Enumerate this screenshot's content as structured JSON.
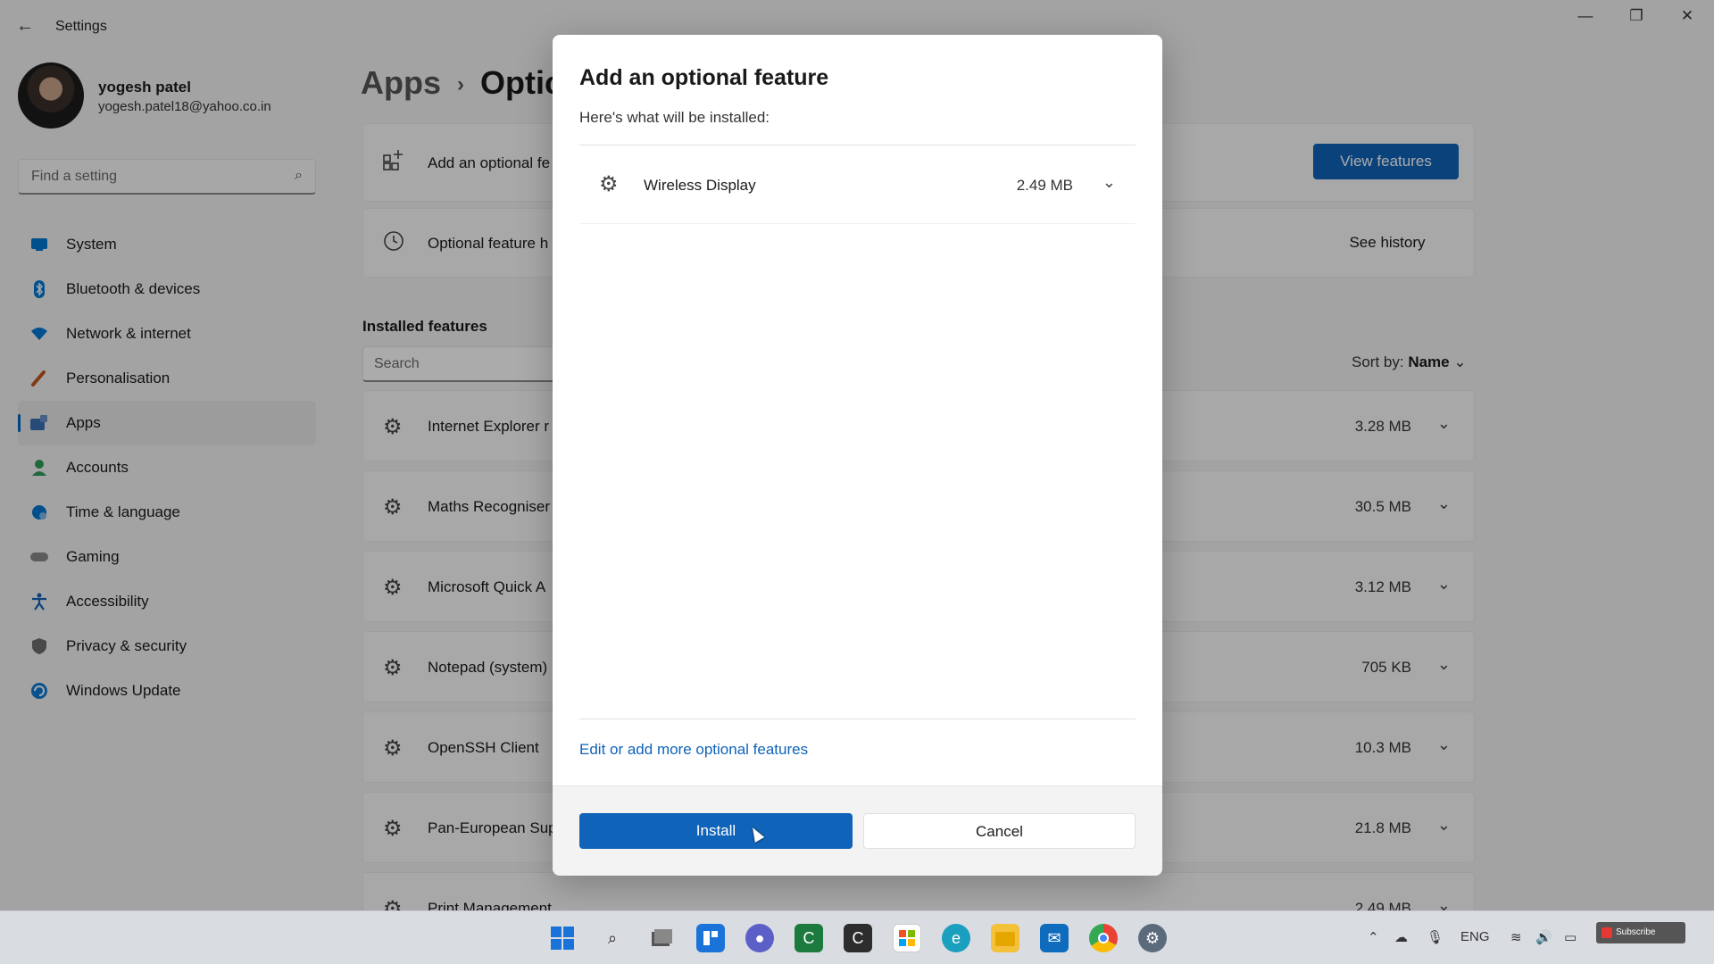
{
  "window": {
    "title": "Settings",
    "back": "←",
    "minimize": "—",
    "maximize": "❐",
    "close": "✕"
  },
  "user": {
    "name": "yogesh patel",
    "email": "yogesh.patel18@yahoo.co.in"
  },
  "sidebar": {
    "search_placeholder": "Find a setting",
    "search_icon": "⌕",
    "items": [
      {
        "label": "System",
        "icon": "system-icon",
        "color": "#0078d4"
      },
      {
        "label": "Bluetooth & devices",
        "icon": "bluetooth-icon",
        "color": "#0078d4"
      },
      {
        "label": "Network & internet",
        "icon": "wifi-icon",
        "color": "#0078d4"
      },
      {
        "label": "Personalisation",
        "icon": "brush-icon",
        "color": "#c2561a"
      },
      {
        "label": "Apps",
        "icon": "apps-icon",
        "color": "#3d6fb4"
      },
      {
        "label": "Accounts",
        "icon": "person-icon",
        "color": "#2d9f5a"
      },
      {
        "label": "Time & language",
        "icon": "globe-icon",
        "color": "#0078d4"
      },
      {
        "label": "Gaming",
        "icon": "gamepad-icon",
        "color": "#7a7a7a"
      },
      {
        "label": "Accessibility",
        "icon": "accessibility-icon",
        "color": "#0f63b8"
      },
      {
        "label": "Privacy & security",
        "icon": "shield-icon",
        "color": "#6e6e6e"
      },
      {
        "label": "Windows Update",
        "icon": "update-icon",
        "color": "#0f7bd3"
      }
    ]
  },
  "main": {
    "breadcrumb_parent": "Apps",
    "breadcrumb_sep": "›",
    "breadcrumb_current": "Optic",
    "add_feature_label": "Add an optional fe",
    "view_features_button": "View features",
    "history_label": "Optional feature h",
    "see_history_button": "See history",
    "installed_title": "Installed features",
    "search_placeholder": "Search",
    "sort_label": "Sort by:",
    "sort_value": "Name",
    "features": [
      {
        "name": "Internet Explorer r",
        "size": "3.28 MB"
      },
      {
        "name": "Maths Recogniser",
        "size": "30.5 MB"
      },
      {
        "name": "Microsoft Quick A",
        "size": "3.12 MB"
      },
      {
        "name": "Notepad (system)",
        "size": "705 KB"
      },
      {
        "name": "OpenSSH Client",
        "size": "10.3 MB"
      },
      {
        "name": "Pan-European Sup",
        "size": "21.8 MB"
      },
      {
        "name": "Print Management",
        "size": "2.49 MB"
      }
    ]
  },
  "dialog": {
    "title": "Add an optional feature",
    "subtitle": "Here's what will be installed:",
    "item_name": "Wireless Display",
    "item_size": "2.49 MB",
    "link": "Edit or add more optional features",
    "install_button": "Install",
    "cancel_button": "Cancel"
  },
  "taskbar": {
    "lang": "ENG",
    "subscribe": "Subscribe"
  },
  "colors": {
    "accent": "#0f63b8"
  }
}
